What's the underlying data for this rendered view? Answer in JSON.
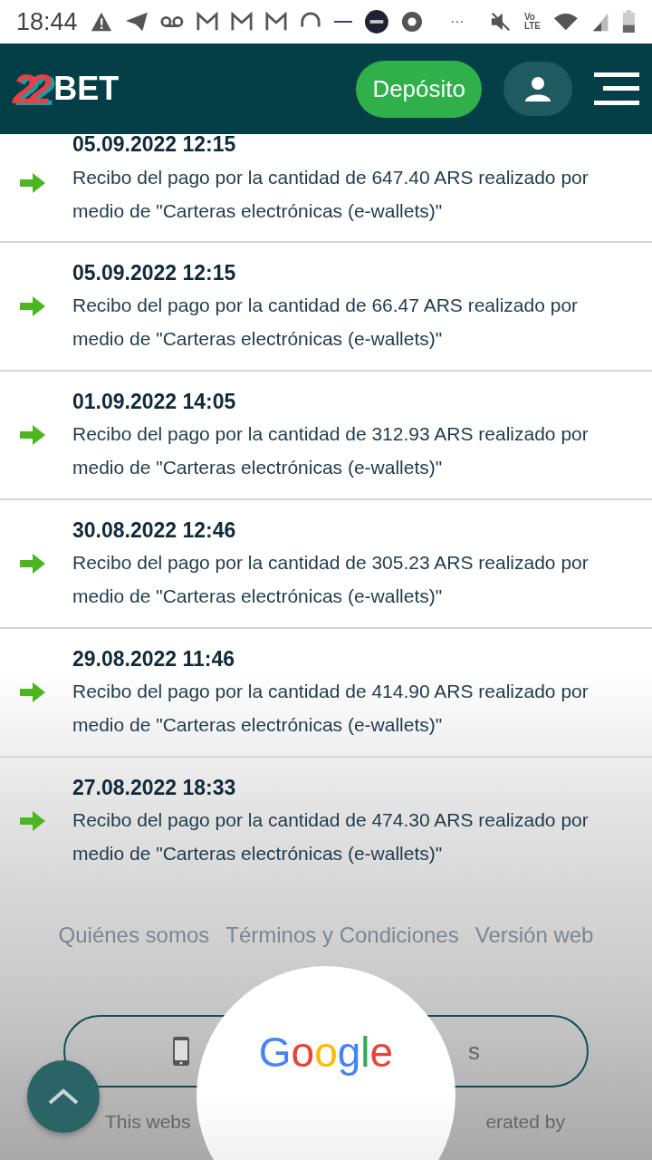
{
  "status_bar": {
    "time": "18:44",
    "more": "···",
    "network": "Vo LTE"
  },
  "header": {
    "logo_digits": "22",
    "logo_word": "BET",
    "deposit_button": "Depósito"
  },
  "transactions": [
    {
      "date": "05.09.2022 12:15",
      "text": "Recibo del pago por la cantidad de 647.40 ARS realizado por medio de \"Carteras electrónicas (e-wallets)\""
    },
    {
      "date": "05.09.2022 12:15",
      "text": "Recibo del pago por la cantidad de 66.47 ARS realizado por medio de \"Carteras electrónicas (e-wallets)\""
    },
    {
      "date": "01.09.2022 14:05",
      "text": "Recibo del pago por la cantidad de 312.93 ARS realizado por medio de \"Carteras electrónicas (e-wallets)\""
    },
    {
      "date": "30.08.2022 12:46",
      "text": "Recibo del pago por la cantidad de 305.23 ARS realizado por medio de \"Carteras electrónicas (e-wallets)\""
    },
    {
      "date": "29.08.2022 11:46",
      "text": "Recibo del pago por la cantidad de 414.90 ARS realizado por medio de \"Carteras electrónicas (e-wallets)\""
    },
    {
      "date": "27.08.2022 18:33",
      "text": "Recibo del pago por la cantidad de 474.30 ARS realizado por medio de \"Carteras electrónicas (e-wallets)\""
    }
  ],
  "footer": {
    "links": [
      "Quiénes somos",
      "Términos y Condiciones",
      "Versión web"
    ],
    "app_button_fragment": "s",
    "notice_left": "This webs",
    "notice_right": "erated by"
  },
  "overlay": {
    "logo": "Google"
  }
}
